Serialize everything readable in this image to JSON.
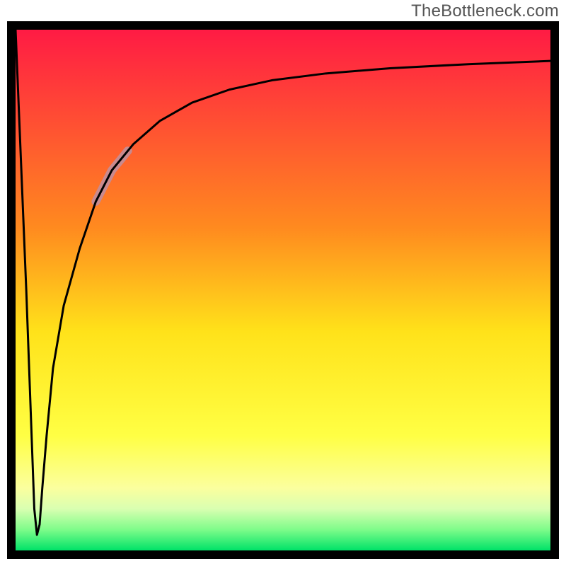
{
  "watermark": "TheBottleneck.com",
  "chart_data": {
    "type": "line",
    "title": "",
    "xlabel": "",
    "ylabel": "",
    "xlim": [
      0,
      100
    ],
    "ylim": [
      0,
      100
    ],
    "grid": false,
    "legend": false,
    "background_gradient": {
      "stops": [
        {
          "pos": 0.0,
          "color": "#ff1b44"
        },
        {
          "pos": 0.38,
          "color": "#ff8a1f"
        },
        {
          "pos": 0.58,
          "color": "#ffe21a"
        },
        {
          "pos": 0.78,
          "color": "#ffff44"
        },
        {
          "pos": 0.88,
          "color": "#fbff9e"
        },
        {
          "pos": 0.92,
          "color": "#d9ffb1"
        },
        {
          "pos": 0.96,
          "color": "#7efc8a"
        },
        {
          "pos": 1.0,
          "color": "#00e268"
        }
      ]
    },
    "marker": {
      "x_range": [
        15,
        21
      ],
      "y_range": [
        70,
        78
      ],
      "color": "#c98a8e"
    },
    "series": [
      {
        "name": "curve",
        "x": [
          0,
          2,
          3.5,
          4,
          4.5,
          5,
          5.8,
          7,
          9,
          12,
          15,
          18,
          22,
          27,
          33,
          40,
          48,
          58,
          70,
          85,
          100
        ],
        "y": [
          100,
          50,
          8,
          3,
          5,
          12,
          22,
          35,
          47,
          58,
          67,
          73,
          78,
          82.5,
          86,
          88.5,
          90.3,
          91.6,
          92.6,
          93.4,
          94
        ]
      }
    ]
  }
}
